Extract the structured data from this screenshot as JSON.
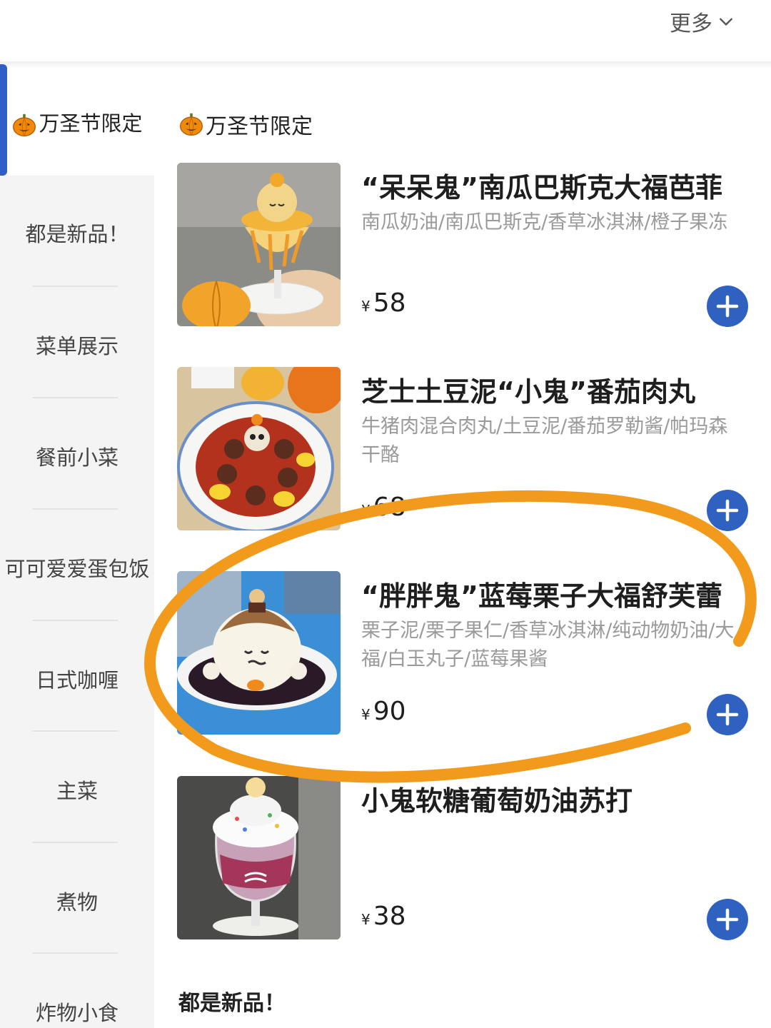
{
  "header": {
    "more_label": "更多"
  },
  "sidebar": {
    "items": [
      {
        "label": "万圣节限定",
        "active": true
      },
      {
        "label": "都是新品！"
      },
      {
        "label": "菜单展示"
      },
      {
        "label": "餐前小菜"
      },
      {
        "label": "可可爱爱蛋包饭"
      },
      {
        "label": "日式咖喱"
      },
      {
        "label": "主菜"
      },
      {
        "label": "煮物"
      },
      {
        "label": "炸物小食"
      }
    ]
  },
  "main": {
    "section_title": "万圣节限定",
    "items": [
      {
        "name": "“呆呆鬼”南瓜巴斯克大福芭菲",
        "desc": "南瓜奶油/南瓜巴斯克/香草冰淇淋/橙子果冻",
        "currency": "¥",
        "price": "58"
      },
      {
        "name": "芝士土豆泥“小鬼”番茄肉丸",
        "desc": "牛猪肉混合肉丸/土豆泥/番茄罗勒酱/帕玛森干酪",
        "currency": "¥",
        "price": "68"
      },
      {
        "name": "“胖胖鬼”蓝莓栗子大福舒芙蕾",
        "desc": "栗子泥/栗子果仁/香草冰淇淋/纯动物奶油/大福/白玉丸子/蓝莓果酱",
        "currency": "¥",
        "price": "90"
      },
      {
        "name": "小鬼软糖葡萄奶油苏打",
        "desc": "",
        "currency": "¥",
        "price": "38"
      }
    ],
    "next_section_title": "都是新品！"
  },
  "colors": {
    "accent": "#2f62c0",
    "annotation": "#f29a1c"
  }
}
